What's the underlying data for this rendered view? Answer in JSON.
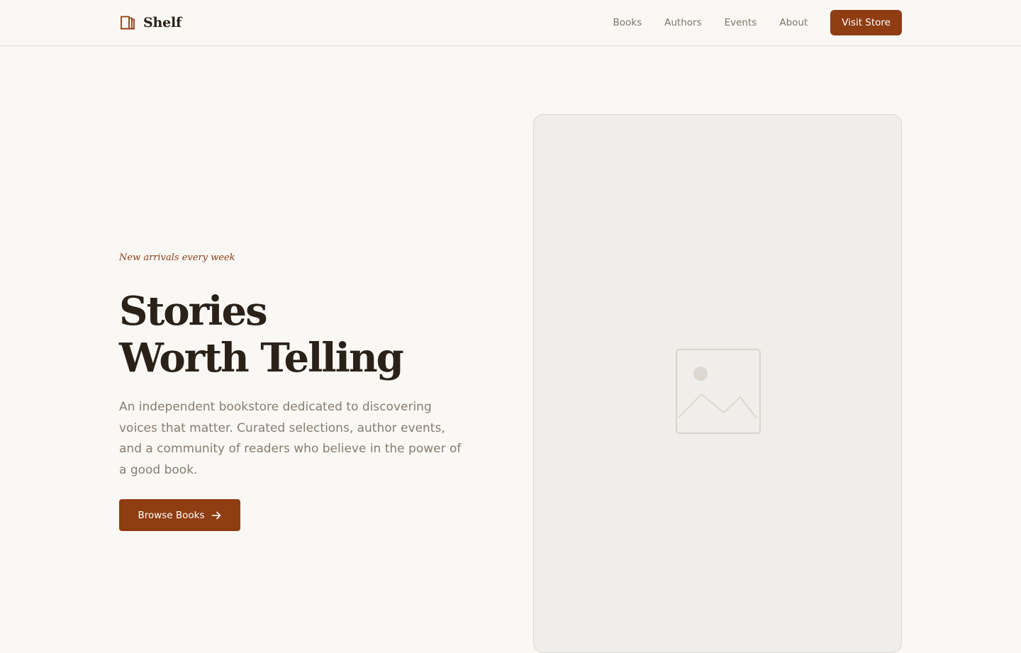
{
  "brand": {
    "name": "Shelf",
    "icon": "book-icon",
    "accent_color": "#8f3d12"
  },
  "nav": {
    "links": [
      "Books",
      "Authors",
      "Events",
      "About"
    ],
    "cta_label": "Visit Store"
  },
  "hero": {
    "eyebrow": "New arrivals every week",
    "headline_line1": "Stories",
    "headline_line2": "Worth Telling",
    "description": "An independent bookstore dedicated to discovering voices that matter. Curated selections, author events, and a community of readers who believe in the power of a good book.",
    "button_label": "Browse Books",
    "button_icon": "arrow-right-icon",
    "image_icon": "image-placeholder-icon"
  }
}
